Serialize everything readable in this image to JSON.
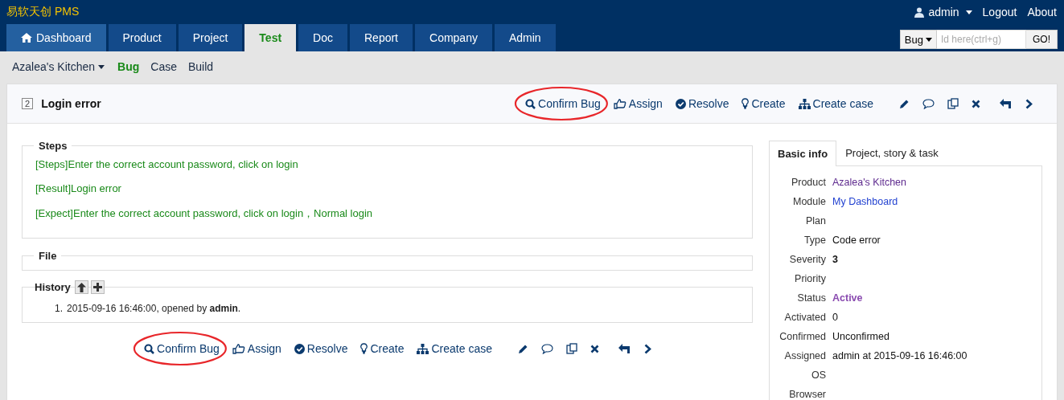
{
  "brand": {
    "name": "易软天创",
    "product": "PMS"
  },
  "user_menu": {
    "user": "admin",
    "links": [
      "Logout",
      "About"
    ]
  },
  "nav_tabs": [
    {
      "label": "Dashboard",
      "kind": "home",
      "selected": false
    },
    {
      "label": "Product",
      "kind": "plain",
      "selected": false
    },
    {
      "label": "Project",
      "kind": "plain",
      "selected": false
    },
    {
      "label": "Test",
      "kind": "plain",
      "selected": true
    },
    {
      "label": "Doc",
      "kind": "plain",
      "selected": false
    },
    {
      "label": "Report",
      "kind": "plain",
      "selected": false
    },
    {
      "label": "Company",
      "kind": "plain",
      "selected": false
    },
    {
      "label": "Admin",
      "kind": "plain",
      "selected": false
    }
  ],
  "quick_search": {
    "type": "Bug",
    "placeholder": "Id here(ctrl+g)",
    "button": "GO!"
  },
  "sub_nav": {
    "product": "Azalea's Kitchen",
    "items": [
      {
        "label": "Bug",
        "selected": true
      },
      {
        "label": "Case",
        "selected": false
      },
      {
        "label": "Build",
        "selected": false
      }
    ]
  },
  "bug": {
    "id": "2",
    "title": "Login error"
  },
  "top_actions": [
    {
      "kind": "confirm",
      "label": "Confirm Bug",
      "circled": true
    },
    {
      "kind": "assign",
      "label": "Assign",
      "circled": false
    },
    {
      "kind": "resolve",
      "label": "Resolve",
      "circled": false
    },
    {
      "kind": "create",
      "label": "Create",
      "circled": false
    },
    {
      "kind": "case",
      "label": "Create case",
      "circled": false
    },
    {
      "kind": "edit",
      "circled": false
    },
    {
      "kind": "comment",
      "circled": false
    },
    {
      "kind": "copy",
      "circled": false
    },
    {
      "kind": "delete",
      "circled": false
    },
    {
      "kind": "back",
      "circled": false
    },
    {
      "kind": "next",
      "circled": false
    }
  ],
  "bottom_actions": [
    {
      "kind": "confirm",
      "label": "Confirm Bug",
      "circled": true
    },
    {
      "kind": "assign",
      "label": "Assign",
      "circled": false
    },
    {
      "kind": "resolve",
      "label": "Resolve",
      "circled": false
    },
    {
      "kind": "create",
      "label": "Create",
      "circled": false
    },
    {
      "kind": "case",
      "label": "Create case",
      "circled": false
    },
    {
      "kind": "edit",
      "circled": false
    },
    {
      "kind": "comment",
      "circled": false
    },
    {
      "kind": "copy",
      "circled": false
    },
    {
      "kind": "delete",
      "circled": false
    },
    {
      "kind": "back",
      "circled": false
    },
    {
      "kind": "next",
      "circled": false
    }
  ],
  "steps": {
    "title": "Steps",
    "lines": [
      "[Steps]Enter the correct account password, click on login",
      "[Result]Login error",
      "[Expect]Enter the correct account password, click on login，Normal login"
    ]
  },
  "file": {
    "title": "File"
  },
  "history": {
    "title": "History",
    "entries": [
      {
        "number": "1.",
        "text": "2015-09-16 16:46:00, opened by **admin**."
      }
    ]
  },
  "info_tabs": [
    {
      "label": "Basic info",
      "selected": true
    },
    {
      "label": "Project, story & task",
      "selected": false
    }
  ],
  "basic_info": [
    {
      "label": "Product",
      "value": "Azalea's Kitchen",
      "kind": "visited"
    },
    {
      "label": "Module",
      "value": "My Dashboard",
      "kind": "link"
    },
    {
      "label": "Plan"
    },
    {
      "label": "Type",
      "value": "Code error",
      "kind": "plain"
    },
    {
      "label": "Severity",
      "value": "3",
      "kind": "strong"
    },
    {
      "label": "Priority"
    },
    {
      "label": "Status",
      "value": "Active",
      "kind": "status"
    },
    {
      "label": "Activated",
      "value": "0",
      "kind": "plain"
    },
    {
      "label": "Confirmed",
      "value": "Unconfirmed",
      "kind": "plain"
    },
    {
      "label": "Assigned",
      "value": "admin at 2015-09-16 16:46:00",
      "kind": "plain"
    },
    {
      "label": "OS"
    },
    {
      "label": "Browser"
    }
  ]
}
